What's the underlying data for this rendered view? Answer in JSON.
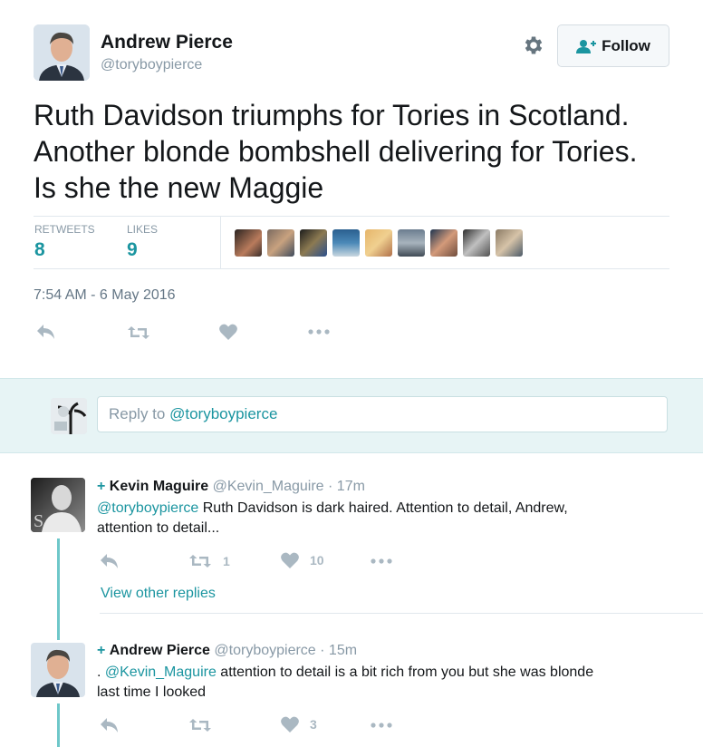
{
  "tweet": {
    "author_name": "Andrew Pierce",
    "author_handle": "@toryboypierce",
    "text_lines": [
      "Ruth Davidson triumphs for Tories in Scotland.",
      "Another blonde bombshell delivering for Tories.",
      "Is she the new Maggie"
    ],
    "follow_label": "Follow",
    "stats": {
      "retweets_label": "RETWEETS",
      "retweets_count": "8",
      "likes_label": "LIKES",
      "likes_count": "9"
    },
    "timestamp": "7:54 AM - 6 May 2016",
    "liker_avatar_count": 9
  },
  "reply_box": {
    "prefix": "Reply to ",
    "handle": "@toryboypierce"
  },
  "replies": [
    {
      "plus": "+",
      "author_name": "Kevin Maguire",
      "author_handle": "@Kevin_Maguire",
      "time": "· 17m",
      "mention": "@toryboypierce",
      "text_1": " Ruth Davidson is dark haired. Attention to detail, Andrew,",
      "text_2": "attention to detail...",
      "retweet_count": "1",
      "like_count": "10",
      "view_other_replies": "View other replies"
    },
    {
      "plus": "+",
      "author_name": "Andrew Pierce",
      "author_handle": "@toryboypierce",
      "time": "· 15m",
      "prefix": ". ",
      "mention": "@Kevin_Maguire",
      "text_1": " attention to detail is a bit rich from you but she was blonde",
      "text_2": "last time I looked",
      "retweet_count": "",
      "like_count": "3"
    }
  ],
  "colors": {
    "accent": "#1b95a0",
    "muted": "#8899a6",
    "reply_bg": "#e7f4f5",
    "thread_line": "#6ec7c9"
  }
}
